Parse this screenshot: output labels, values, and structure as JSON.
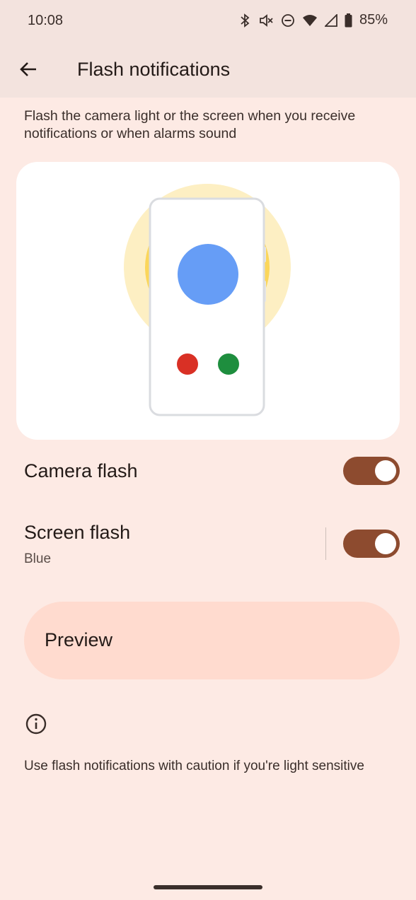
{
  "status_bar": {
    "time": "10:08",
    "battery": "85%",
    "icons": [
      "bluetooth-icon",
      "mute-icon",
      "do-not-disturb-icon",
      "wifi-icon",
      "signal-icon",
      "battery-icon"
    ]
  },
  "app_bar": {
    "back_icon": "arrow-back-icon",
    "title": "Flash notifications"
  },
  "description": "Flash the camera light or the screen when you receive notifications or when alarms sound",
  "settings": {
    "camera_flash": {
      "label": "Camera flash",
      "enabled": true
    },
    "screen_flash": {
      "label": "Screen flash",
      "color": "Blue",
      "enabled": true
    }
  },
  "preview_button": {
    "label": "Preview"
  },
  "info": {
    "icon": "info-icon",
    "text": "Use flash notifications with caution if you're light sensitive"
  },
  "colors": {
    "background": "#fdeae4",
    "toggle_on": "#8d4b2f",
    "preview_button": "#ffdbcf",
    "illustration_blue": "#669df6",
    "illustration_red": "#d93025",
    "illustration_green": "#1e8e3e",
    "illustration_glow": "#fdefc3"
  }
}
